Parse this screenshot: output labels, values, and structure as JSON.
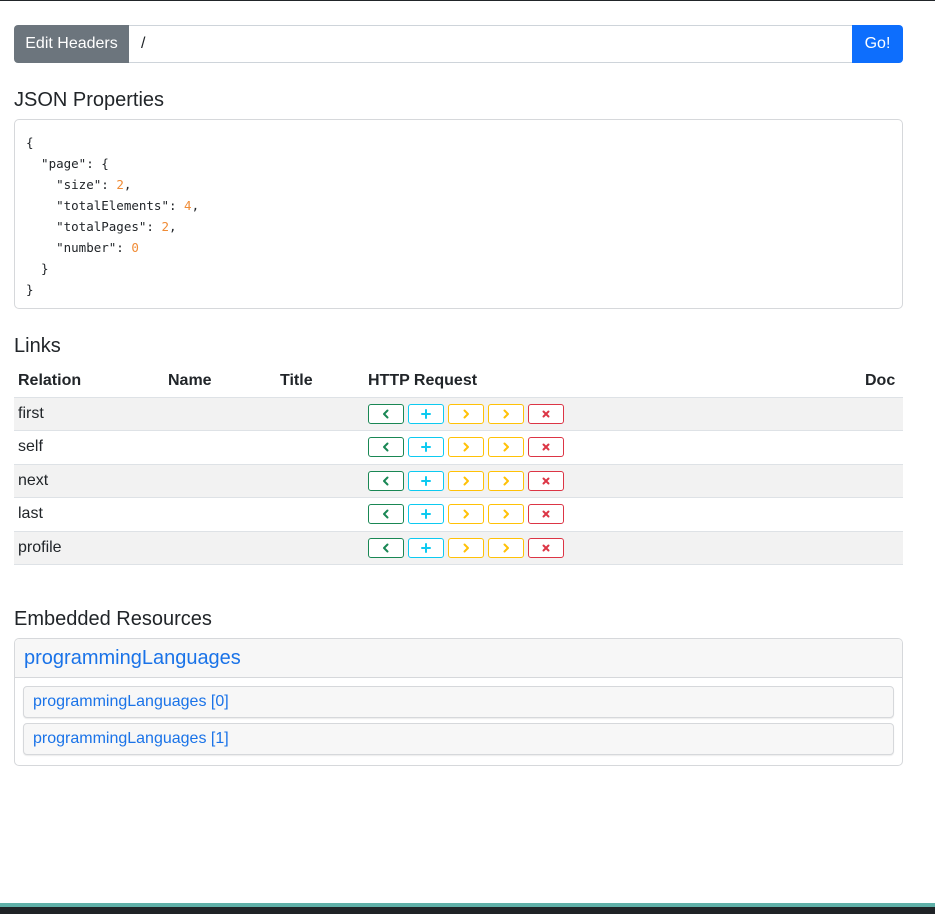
{
  "url_bar": {
    "edit_headers_label": "Edit Headers",
    "url_value": "/",
    "go_label": "Go!"
  },
  "json_section": {
    "title": "JSON Properties",
    "properties": {
      "page": {
        "size": 2,
        "totalElements": 4,
        "totalPages": 2,
        "number": 0
      }
    }
  },
  "links_section": {
    "title": "Links",
    "columns": [
      "Relation",
      "Name",
      "Title",
      "HTTP Request",
      "Doc"
    ],
    "rows": [
      {
        "relation": "first",
        "name": "",
        "title": ""
      },
      {
        "relation": "self",
        "name": "",
        "title": ""
      },
      {
        "relation": "next",
        "name": "",
        "title": ""
      },
      {
        "relation": "last",
        "name": "",
        "title": ""
      },
      {
        "relation": "profile",
        "name": "",
        "title": ""
      }
    ],
    "request_buttons": [
      "get",
      "post",
      "put",
      "patch",
      "delete"
    ],
    "request_icons": [
      "chevron-left-icon",
      "plus-icon",
      "chevron-right-icon",
      "chevron-right-icon",
      "x-icon"
    ],
    "request_colors": {
      "get": "#198754",
      "post": "#0dcaf0",
      "put": "#ffc107",
      "patch": "#ffc107",
      "delete": "#dc3545"
    }
  },
  "embedded_section": {
    "title": "Embedded Resources",
    "resource_name": "programmingLanguages",
    "items": [
      "programmingLanguages [0]",
      "programmingLanguages [1]"
    ]
  }
}
